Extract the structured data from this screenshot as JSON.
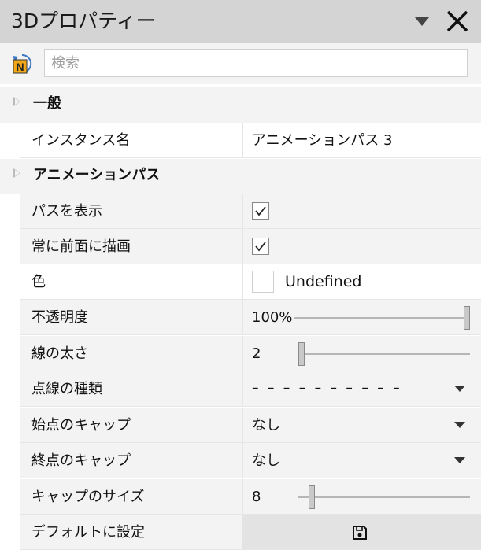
{
  "window": {
    "title": "3Dプロパティー"
  },
  "search": {
    "placeholder": "検索",
    "value": ""
  },
  "sections": {
    "general": {
      "label": "一般",
      "instance_name": {
        "label": "インスタンス名",
        "value": "アニメーションパス 3"
      }
    },
    "animation_path": {
      "label": "アニメーションパス",
      "show_path": {
        "label": "パスを表示",
        "checked": true
      },
      "always_on_top": {
        "label": "常に前面に描画",
        "checked": true
      },
      "color": {
        "label": "色",
        "value": "Undefined"
      },
      "opacity": {
        "label": "不透明度",
        "value": "100%",
        "level": 1.0
      },
      "line_width": {
        "label": "線の太さ",
        "value": "2",
        "level": 0.0
      },
      "dash_type": {
        "label": "点線の種類",
        "value": "– – – – – – – – – –"
      },
      "start_cap": {
        "label": "始点のキャップ",
        "value": "なし"
      },
      "end_cap": {
        "label": "終点のキャップ",
        "value": "なし"
      },
      "cap_size": {
        "label": "キャップのサイズ",
        "value": "8",
        "level": 0.08
      },
      "set_default": {
        "label": "デフォルトに設定"
      }
    }
  },
  "icons": {
    "menu": "chevron-down-icon",
    "close": "close-icon",
    "reset": "reset-icon",
    "save": "save-icon"
  }
}
